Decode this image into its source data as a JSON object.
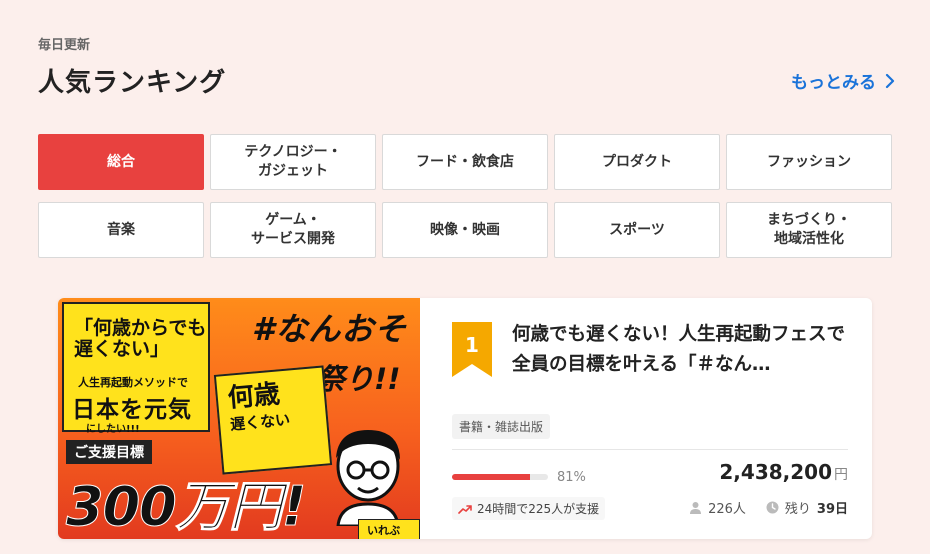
{
  "header": {
    "subtitle": "毎日更新",
    "title": "人気ランキング",
    "more_label": "もっとみる"
  },
  "categories": [
    {
      "label": "総合",
      "active": true
    },
    {
      "label": "テクノロジー・\nガジェット",
      "active": false
    },
    {
      "label": "フード・飲食店",
      "active": false
    },
    {
      "label": "プロダクト",
      "active": false
    },
    {
      "label": "ファッション",
      "active": false
    },
    {
      "label": "音楽",
      "active": false
    },
    {
      "label": "ゲーム・\nサービス開発",
      "active": false
    },
    {
      "label": "映像・映画",
      "active": false
    },
    {
      "label": "スポーツ",
      "active": false
    },
    {
      "label": "まちづくり・\n地域活性化",
      "active": false
    }
  ],
  "project": {
    "rank": "1",
    "title": "何歳でも遅くない！人生再起動フェスで全員の目標を叶える「＃なん…",
    "tag": "書籍・雑誌出版",
    "progress_percent": 81,
    "progress_label": "81%",
    "amount": "2,438,200",
    "currency": "円",
    "trend_text": "24時間で225人が支援",
    "supporters": "226人",
    "remaining_label": "残り",
    "remaining_value": "39日",
    "thumbnail": {
      "headline_1": "「何歳からでも",
      "headline_2": "遅くない」",
      "sub": "人生再起動メソッドで",
      "main": "日本を元気",
      "tail": "にしたい!!!",
      "hashtag_1": "#なんおそ",
      "hashtag_2": "祭り!!",
      "book_1": "何歳",
      "book_2": "遅くない",
      "goal_label": "ご支援目標",
      "goal_value": "300万円!",
      "author": "いれぶん"
    }
  },
  "colors": {
    "accent": "#e8413f",
    "link": "#1a73d9",
    "background": "#fcefec",
    "rank_badge": "#f5a800"
  }
}
